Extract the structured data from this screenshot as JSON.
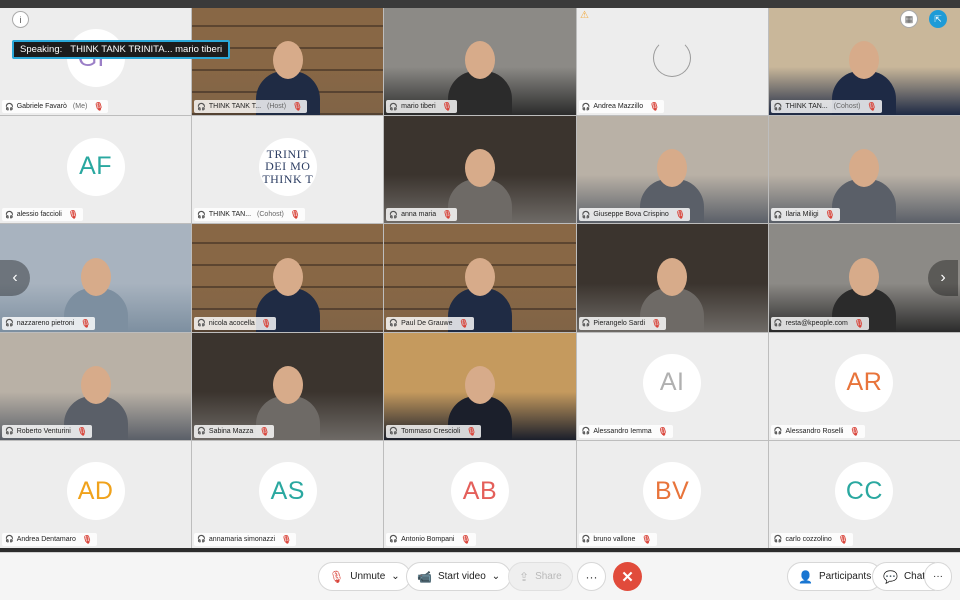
{
  "speaking": {
    "label": "Speaking:",
    "names": "THINK TANK TRINITA...  mario tiberi"
  },
  "participants": [
    {
      "name": "Gabriele Favarò",
      "role": "(Me)",
      "kind": "avatar",
      "initials": "GF",
      "color": "#9b7fc7",
      "mic": false
    },
    {
      "name": "THINK TANK T...",
      "role": "(Host)",
      "kind": "video",
      "scene": "library",
      "active": true,
      "mic": false
    },
    {
      "name": "mario tiberi",
      "role": "",
      "kind": "video",
      "scene": "room",
      "active": true,
      "mic": false
    },
    {
      "name": "Andrea Mazzillo",
      "role": "",
      "kind": "loading",
      "mic": false
    },
    {
      "name": "THINK TAN...",
      "role": "(Cohost)",
      "kind": "video",
      "scene": "office",
      "mic": false
    },
    {
      "name": "alessio faccioli",
      "role": "",
      "kind": "avatar",
      "initials": "AF",
      "color": "#2aa8a0",
      "mic": true
    },
    {
      "name": "THINK TAN...",
      "role": "(Cohost)",
      "kind": "logo",
      "logo_lines": [
        "TRINIT",
        "DEI MO",
        "THINK T"
      ],
      "mic": true
    },
    {
      "name": "anna maria",
      "role": "",
      "kind": "video",
      "scene": "dark",
      "mic": true
    },
    {
      "name": "Giuseppe Bova Crispino",
      "role": "",
      "kind": "video",
      "scene": "light",
      "mic": true
    },
    {
      "name": "Ilaria Miligi",
      "role": "",
      "kind": "video",
      "scene": "light",
      "mic": true
    },
    {
      "name": "nazzareno pietroni",
      "role": "",
      "kind": "video",
      "scene": "sky",
      "mic": true
    },
    {
      "name": "nicola acocella",
      "role": "",
      "kind": "video",
      "scene": "library",
      "mic": true
    },
    {
      "name": "Paul De Grauwe",
      "role": "",
      "kind": "video",
      "scene": "library",
      "mic": true
    },
    {
      "name": "Pierangelo Sardi",
      "role": "",
      "kind": "video",
      "scene": "dark",
      "mic": true
    },
    {
      "name": "resta@kpeople.com",
      "role": "",
      "kind": "video",
      "scene": "room",
      "mic": true
    },
    {
      "name": "Roberto Venturini",
      "role": "",
      "kind": "video",
      "scene": "light",
      "mic": true
    },
    {
      "name": "Sabina Mazza",
      "role": "",
      "kind": "video",
      "scene": "dark",
      "mic": true
    },
    {
      "name": "Tommaso Crescioli",
      "role": "",
      "kind": "video",
      "scene": "window",
      "mic": true
    },
    {
      "name": "Alessandro Iemma",
      "role": "",
      "kind": "avatar",
      "initials": "AI",
      "color": "#b0b0b0",
      "mic": true
    },
    {
      "name": "Alessandro Roselli",
      "role": "",
      "kind": "avatar",
      "initials": "AR",
      "color": "#e8743b",
      "mic": true
    },
    {
      "name": "Andrea Dentamaro",
      "role": "",
      "kind": "avatar",
      "initials": "AD",
      "color": "#f0a21b",
      "mic": true
    },
    {
      "name": "annamaria simonazzi",
      "role": "",
      "kind": "avatar",
      "initials": "AS",
      "color": "#2aa8a0",
      "mic": true
    },
    {
      "name": "Antonio Bompani",
      "role": "",
      "kind": "avatar",
      "initials": "AB",
      "color": "#e45f5a",
      "mic": true
    },
    {
      "name": "bruno vallone",
      "role": "",
      "kind": "avatar",
      "initials": "BV",
      "color": "#e8743b",
      "mic": true
    },
    {
      "name": "carlo cozzolino",
      "role": "",
      "kind": "avatar",
      "initials": "CC",
      "color": "#2aa8a0",
      "mic": true
    }
  ],
  "toolbar": {
    "unmute": "Unmute",
    "start_video": "Start video",
    "share": "Share",
    "participants": "Participants",
    "chat": "Chat"
  },
  "colors": {
    "accent": "#2aa8d9",
    "end_call": "#e14b3b",
    "muted_mic": "#d9453b"
  }
}
